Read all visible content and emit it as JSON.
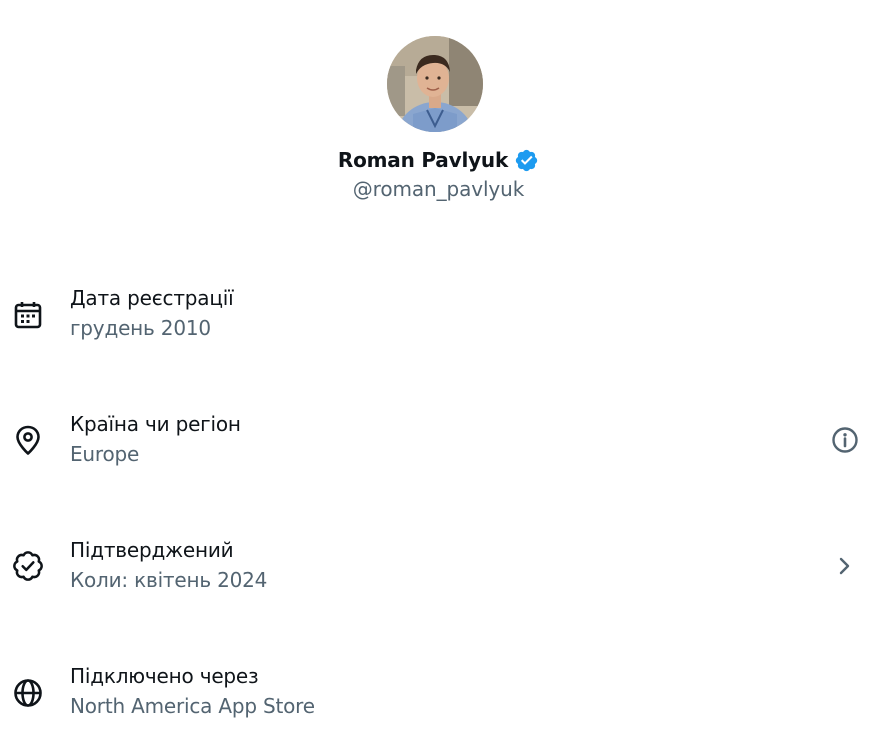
{
  "profile": {
    "display_name": "Roman Pavlyuk",
    "handle": "@roman_pavlyuk",
    "verified_icon": "verified-badge-icon",
    "verified_color": "#1d9bf0"
  },
  "rows": [
    {
      "label": "Дата реєстрації",
      "value": "грудень 2010",
      "icon": "calendar-icon"
    },
    {
      "label": "Країна чи регіон",
      "value": "Europe",
      "icon": "location-pin-icon",
      "trailing_icon": "info-icon"
    },
    {
      "label": "Підтверджений",
      "value": "Коли: квітень 2024",
      "icon": "verified-check-icon",
      "trailing_icon": "chevron-right-icon"
    },
    {
      "label": "Підключено через",
      "value": "North America App Store",
      "icon": "globe-icon"
    }
  ],
  "colors": {
    "primary_text": "#0f1419",
    "secondary_text": "#536471",
    "accent": "#1d9bf0"
  }
}
